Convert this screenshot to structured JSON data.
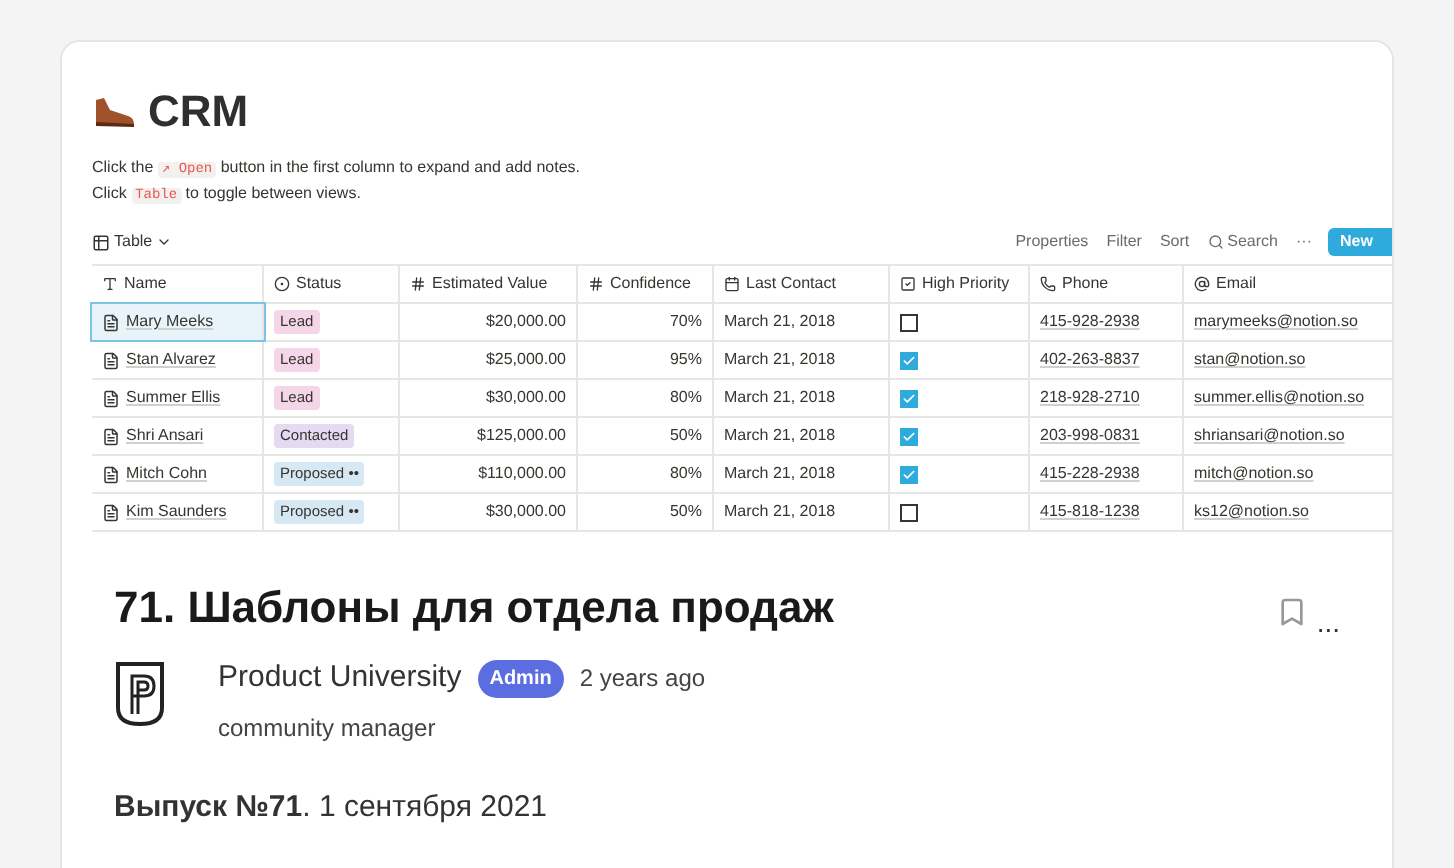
{
  "crm": {
    "title": "CRM",
    "hint_lines": [
      [
        {
          "kind": "text",
          "text": "Click the "
        },
        {
          "kind": "code",
          "text": "↗ Open"
        },
        {
          "kind": "text",
          "text": " button in the first column to expand and add notes."
        }
      ],
      [
        {
          "kind": "text",
          "text": "Click "
        },
        {
          "kind": "code",
          "text": "Table"
        },
        {
          "kind": "text",
          "text": " to toggle between views."
        }
      ]
    ],
    "view": "Table",
    "actions": [
      "Properties",
      "Filter",
      "Sort"
    ],
    "search": "Search",
    "more": "···",
    "new_button": "New",
    "columns": [
      {
        "kind": "title",
        "label": "Name"
      },
      {
        "kind": "select",
        "label": "Status"
      },
      {
        "kind": "number",
        "label": "Estimated Value"
      },
      {
        "kind": "number",
        "label": "Confidence"
      },
      {
        "kind": "date",
        "label": "Last Contact"
      },
      {
        "kind": "checkbox",
        "label": "High Priority"
      },
      {
        "kind": "phone",
        "label": "Phone"
      },
      {
        "kind": "email",
        "label": "Email"
      }
    ],
    "rows": [
      {
        "name": "Mary Meeks",
        "selected": true,
        "status": {
          "label": "Lead",
          "color": "#f5d6e8"
        },
        "value": "$20,000.00",
        "confidence": "70%",
        "last_contact": "March 21, 2018",
        "high_priority": false,
        "phone": "415-928-2938",
        "email": "marymeeks@notion.so"
      },
      {
        "name": "Stan Alvarez",
        "selected": false,
        "status": {
          "label": "Lead",
          "color": "#f5d6e8"
        },
        "value": "$25,000.00",
        "confidence": "95%",
        "last_contact": "March 21, 2018",
        "high_priority": true,
        "phone": "402-263-8837",
        "email": "stan@notion.so"
      },
      {
        "name": "Summer Ellis",
        "selected": false,
        "status": {
          "label": "Lead",
          "color": "#f5d6e8"
        },
        "value": "$30,000.00",
        "confidence": "80%",
        "last_contact": "March 21, 2018",
        "high_priority": true,
        "phone": "218-928-2710",
        "email": "summer.ellis@notion.so"
      },
      {
        "name": "Shri Ansari",
        "selected": false,
        "status": {
          "label": "Contacted",
          "color": "#e4daf2"
        },
        "value": "$125,000.00",
        "confidence": "50%",
        "last_contact": "March 21, 2018",
        "high_priority": true,
        "phone": "203-998-0831",
        "email": "shriansari@notion.so"
      },
      {
        "name": "Mitch Cohn",
        "selected": false,
        "status": {
          "label": "Proposed ••",
          "color": "#d6e8f3"
        },
        "value": "$110,000.00",
        "confidence": "80%",
        "last_contact": "March 21, 2018",
        "high_priority": true,
        "phone": "415-228-2938",
        "email": "mitch@notion.so"
      },
      {
        "name": "Kim Saunders",
        "selected": false,
        "status": {
          "label": "Proposed ••",
          "color": "#d6e8f3"
        },
        "value": "$30,000.00",
        "confidence": "50%",
        "last_contact": "March 21, 2018",
        "high_priority": false,
        "phone": "415-818-1238",
        "email": "ks12@notion.so"
      }
    ]
  },
  "post": {
    "title": "71. Шаблоны для отдела продаж",
    "author": "Product University",
    "badge": "Admin",
    "time": "2 years ago",
    "role": "community manager",
    "more": "...",
    "body": "**Выпуск №71**. 1 сентября 2021"
  }
}
